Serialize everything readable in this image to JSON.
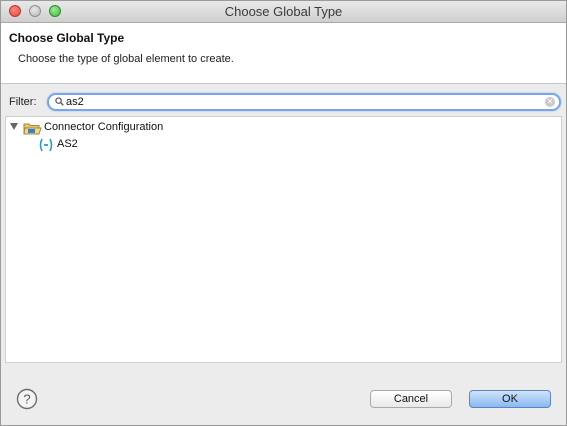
{
  "window": {
    "title": "Choose Global Type"
  },
  "header": {
    "title": "Choose Global Type",
    "description": "Choose the type of global element to create."
  },
  "filter": {
    "label": "Filter:",
    "value": "as2"
  },
  "tree": {
    "items": [
      {
        "label": "Connector Configuration",
        "icon": "folder-icon",
        "expanded": true,
        "children": [
          {
            "label": "AS2",
            "icon": "connector-icon"
          }
        ]
      }
    ]
  },
  "buttons": {
    "cancel_label": "Cancel",
    "ok_label": "OK"
  },
  "colors": {
    "ok_button": "#8ab9f0",
    "filter_focus": "#7aa7e3"
  }
}
